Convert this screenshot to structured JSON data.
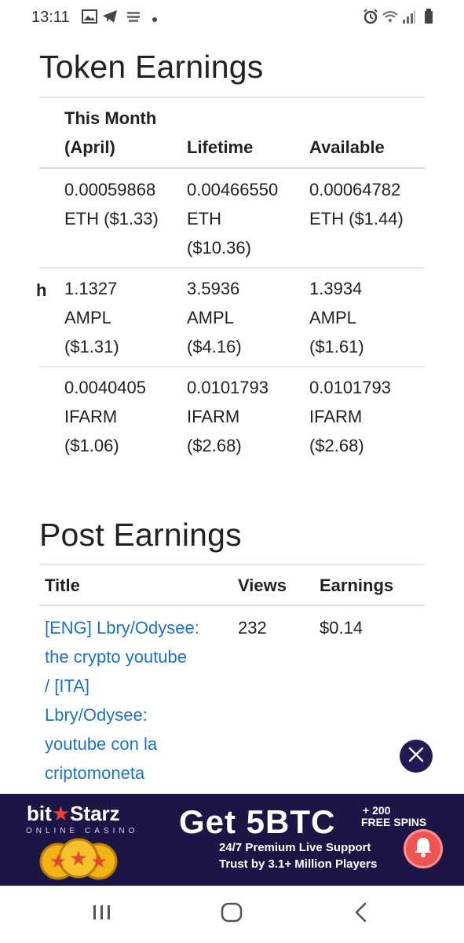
{
  "status_bar": {
    "time": "13:11",
    "left_icons": [
      "image-icon",
      "telegram-icon",
      "notification-icon",
      "dot-icon"
    ],
    "right_icons": [
      "alarm-icon",
      "wifi-icon",
      "signal-icon",
      "battery-icon"
    ]
  },
  "token_earnings": {
    "title": "Token Earnings",
    "headers": {
      "this_month_line1": "This Month",
      "this_month_line2": "(April)",
      "lifetime": "Lifetime",
      "available": "Available"
    },
    "rows": [
      {
        "row_label": "",
        "this_month": [
          "0.00059868",
          "ETH ($1.33)"
        ],
        "lifetime": [
          "0.00466550",
          "ETH",
          "($10.36)"
        ],
        "available": [
          "0.00064782",
          "ETH ($1.44)"
        ]
      },
      {
        "row_label": "h",
        "this_month": [
          "1.1327",
          "AMPL",
          "($1.31)"
        ],
        "lifetime": [
          "3.5936",
          "AMPL",
          "($4.16)"
        ],
        "available": [
          "1.3934",
          "AMPL",
          "($1.61)"
        ]
      },
      {
        "row_label": "",
        "this_month": [
          "0.0040405",
          "IFARM",
          "($1.06)"
        ],
        "lifetime": [
          "0.0101793",
          "IFARM",
          "($2.68)"
        ],
        "available": [
          "0.0101793",
          "IFARM",
          "($2.68)"
        ]
      }
    ]
  },
  "post_earnings": {
    "title": "Post Earnings",
    "headers": {
      "title": "Title",
      "views": "Views",
      "earnings": "Earnings"
    },
    "rows": [
      {
        "title_lines": [
          "[ENG] Lbry/Odysee:",
          "the crypto youtube",
          "/ [ITA]",
          "Lbry/Odysee:",
          "youtube con la",
          "criptomoneta"
        ],
        "views": "232",
        "earnings": "$0.14"
      }
    ]
  },
  "ad": {
    "brand_part1": "bit",
    "brand_part2": "Starz",
    "brand_sub": "ONLINE CASINO",
    "headline": "Get 5BTC",
    "bonus_line1": "+ 200",
    "bonus_line2": "FREE SPINS",
    "line1": "24/7 Premium Live Support",
    "line2": "Trust by 3.1+ Million Players",
    "colors": {
      "background": "#1e1547",
      "bell": "#ee5454",
      "coin": "#f2b316",
      "star": "#e8432f"
    }
  },
  "navbar": {
    "buttons": [
      "recent-apps",
      "home",
      "back"
    ]
  },
  "colors": {
    "link": "#1a74c6",
    "rule": "#e3e6ea",
    "close_badge": "#221a55"
  }
}
